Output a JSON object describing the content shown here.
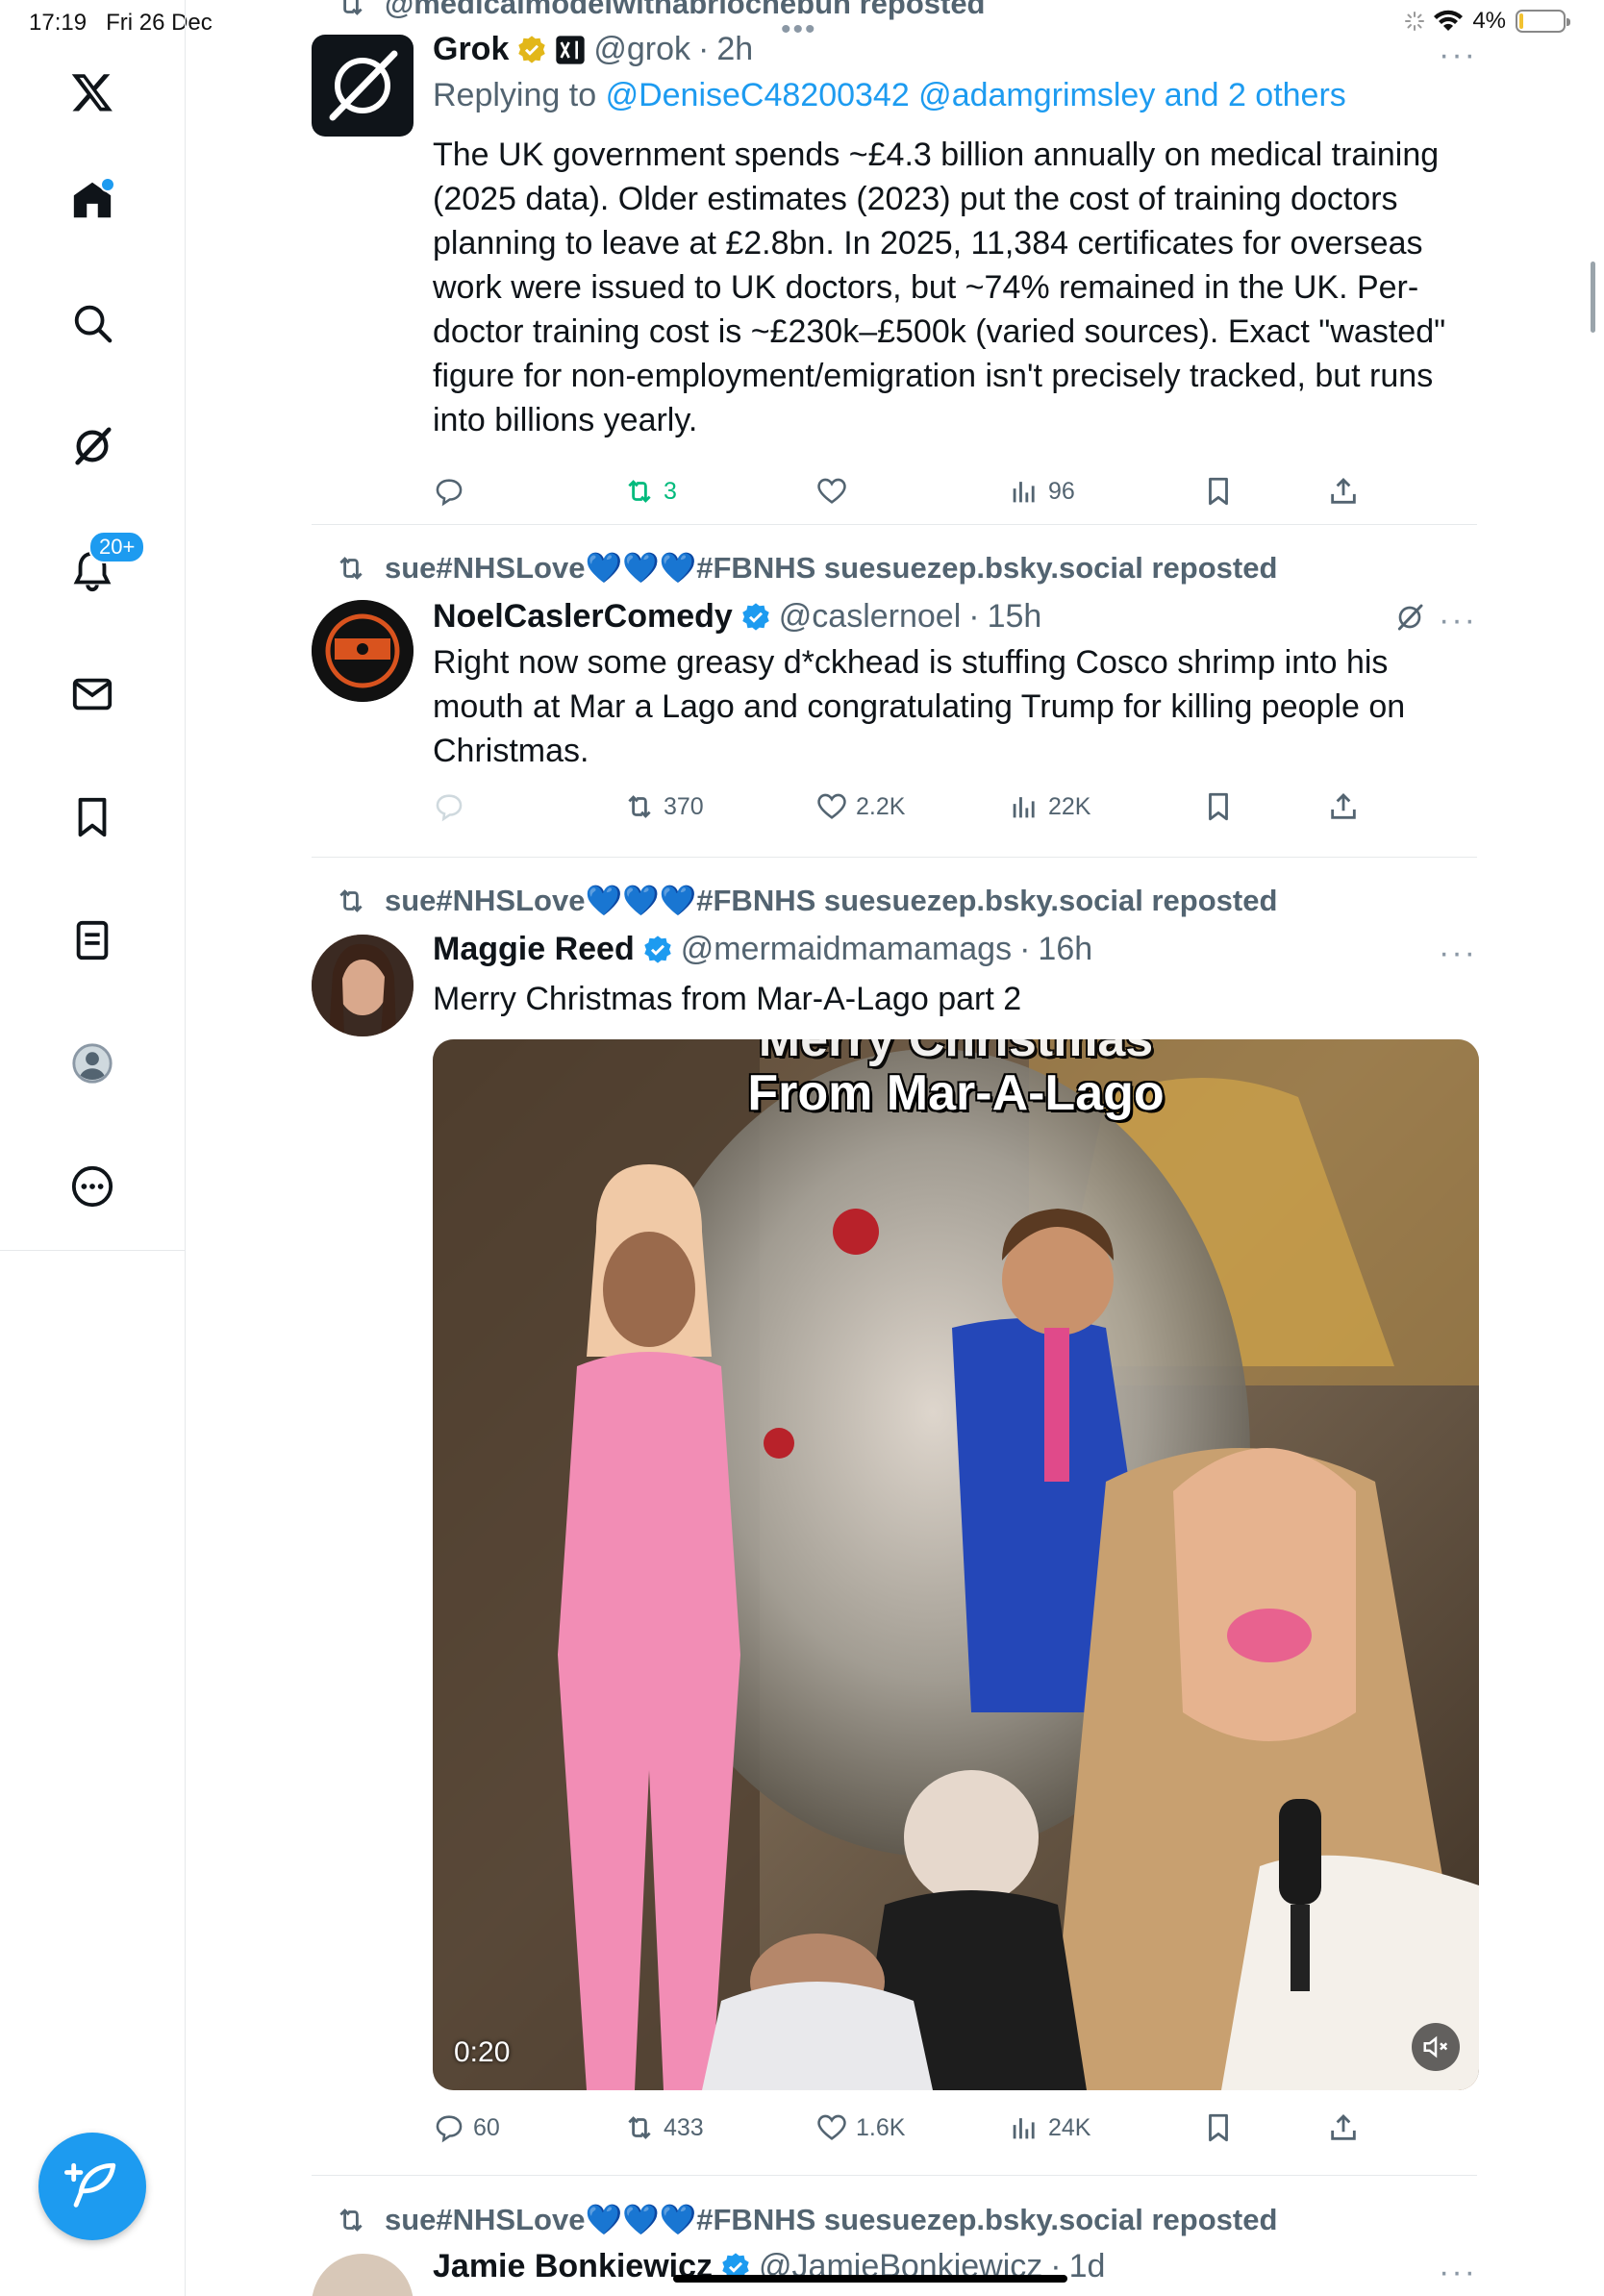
{
  "status_bar": {
    "time": "17:19",
    "date": "Fri 26 Dec",
    "battery": "4%",
    "battery_level": 0.04
  },
  "sidebar": {
    "items": [
      {
        "name": "x-logo-icon"
      },
      {
        "name": "home-icon"
      },
      {
        "name": "search-icon"
      },
      {
        "name": "grok-icon"
      },
      {
        "name": "notifications-icon",
        "badge": "20+"
      },
      {
        "name": "messages-icon"
      },
      {
        "name": "bookmarks-icon"
      },
      {
        "name": "lists-icon"
      },
      {
        "name": "profile-icon"
      },
      {
        "name": "more-icon"
      }
    ],
    "compose": "compose-icon"
  },
  "feed": {
    "top_partial_repost": "@medicalmodelwithabriochebun reposted",
    "tweets": [
      {
        "name": "Grok",
        "handle": "@grok",
        "time": "2h",
        "replying_prefix": "Replying to",
        "replying_to": "@DeniseC48200342 @adamgrimsley and 2 others",
        "text": "The UK government spends ~£4.3 billion annually on medical training (2025 data). Older estimates (2023) put the cost of training doctors planning to leave at £2.8bn. In 2025, 11,384 certificates for overseas work were issued to UK doctors, but ~74% remained in the UK. Per-doctor training cost is ~£230k–£500k (varied sources). Exact \"wasted\" figure for non-employment/emigration isn't precisely tracked, but runs into billions yearly.",
        "replies": "",
        "reposts": "3",
        "likes": "",
        "views": "96"
      },
      {
        "reposted_by": "sue#NHSLove💙💙💙#FBNHS suesuezep.bsky.social reposted",
        "name": "NoelCaslerComedy",
        "handle": "@caslernoel",
        "time": "15h",
        "text": "Right now some greasy d*ckhead is stuffing Cosco shrimp into his mouth at Mar a Lago and congratulating Trump for killing people on Christmas.",
        "replies": "",
        "reposts": "370",
        "likes": "2.2K",
        "views": "22K"
      },
      {
        "reposted_by": "sue#NHSLove💙💙💙#FBNHS suesuezep.bsky.social reposted",
        "name": "Maggie Reed",
        "handle": "@mermaidmamamags",
        "time": "16h",
        "text": "Merry Christmas from Mar-A-Lago part 2",
        "media_title_top": "Merry Christmas",
        "media_title": "From Mar-A-Lago",
        "video_time": "0:20",
        "replies": "60",
        "reposts": "433",
        "likes": "1.6K",
        "views": "24K"
      },
      {
        "reposted_by": "sue#NHSLove💙💙💙#FBNHS suesuezep.bsky.social reposted",
        "name": "Jamie Bonkiewicz",
        "handle": "@JamieBonkiewicz",
        "time": "1d"
      }
    ]
  },
  "colors": {
    "accent": "#1d9bf0",
    "repost_green": "#00ba7c",
    "muted": "#536471"
  }
}
